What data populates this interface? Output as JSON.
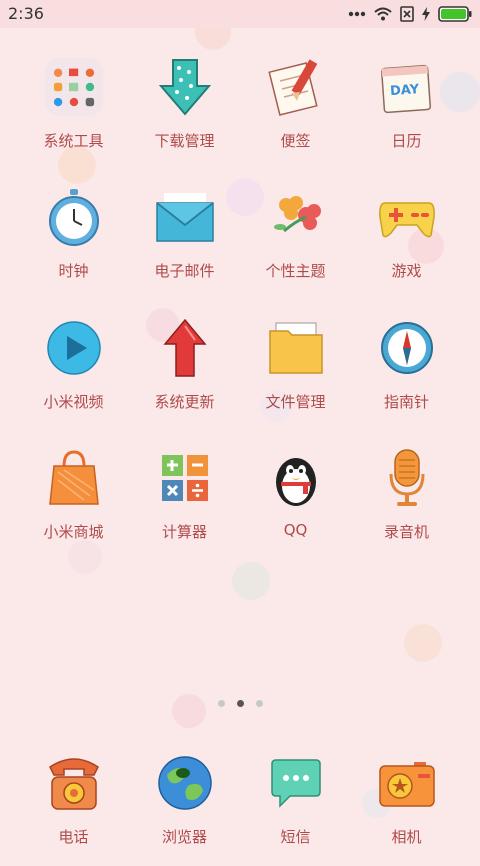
{
  "status_bar": {
    "time": "2:36"
  },
  "apps": [
    {
      "label": "系统工具",
      "icon": "folder-system-tools-icon"
    },
    {
      "label": "下载管理",
      "icon": "download-arrow-icon"
    },
    {
      "label": "便签",
      "icon": "notepad-pencil-icon"
    },
    {
      "label": "日历",
      "icon": "calendar-day-icon"
    },
    {
      "label": "时钟",
      "icon": "clock-icon"
    },
    {
      "label": "电子邮件",
      "icon": "mail-envelope-icon"
    },
    {
      "label": "个性主题",
      "icon": "theme-flowers-icon"
    },
    {
      "label": "游戏",
      "icon": "game-controller-icon"
    },
    {
      "label": "小米视频",
      "icon": "video-play-icon"
    },
    {
      "label": "系统更新",
      "icon": "update-arrow-icon"
    },
    {
      "label": "文件管理",
      "icon": "file-folder-icon"
    },
    {
      "label": "指南针",
      "icon": "compass-icon"
    },
    {
      "label": "小米商城",
      "icon": "shopping-bag-icon"
    },
    {
      "label": "计算器",
      "icon": "calculator-icon"
    },
    {
      "label": "QQ",
      "icon": "qq-penguin-icon"
    },
    {
      "label": "录音机",
      "icon": "microphone-icon"
    }
  ],
  "page_indicator": {
    "count": 3,
    "active_index": 1
  },
  "dock": [
    {
      "label": "电话",
      "icon": "telephone-icon"
    },
    {
      "label": "浏览器",
      "icon": "globe-icon"
    },
    {
      "label": "短信",
      "icon": "message-bubble-icon"
    },
    {
      "label": "相机",
      "icon": "camera-icon"
    }
  ],
  "calendar_icon_text": "DAY"
}
